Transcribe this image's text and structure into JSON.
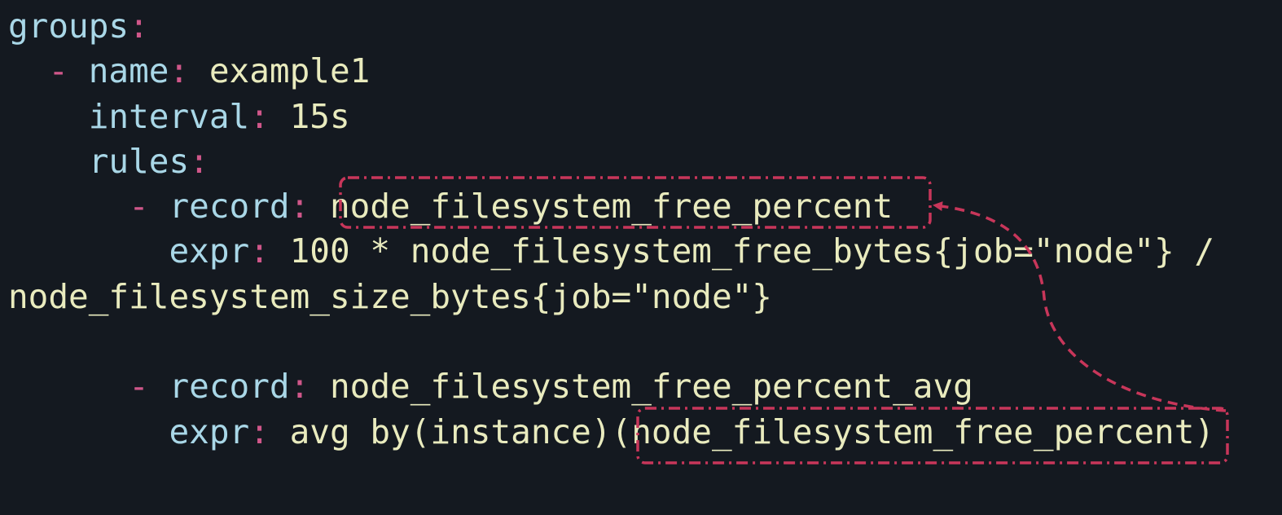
{
  "code": {
    "l1": {
      "key": "groups",
      "colon": ":"
    },
    "l2": {
      "dash": "-",
      "key": "name",
      "colon": ":",
      "value": "example1"
    },
    "l3": {
      "key": "interval",
      "colon": ":",
      "value": "15s"
    },
    "l4": {
      "key": "rules",
      "colon": ":"
    },
    "l5": {
      "dash": "-",
      "key": "record",
      "colon": ":",
      "value": "node_filesystem_free_percent"
    },
    "l6": {
      "key": "expr",
      "colon": ":",
      "value": "100 * node_filesystem_free_bytes{job=\"node\"} /"
    },
    "l7": {
      "value": "node_filesystem_size_bytes{job=\"node\"}"
    },
    "l9": {
      "dash": "-",
      "key": "record",
      "colon": ":",
      "value": "node_filesystem_free_percent_avg"
    },
    "l10": {
      "key": "expr",
      "colon": ":",
      "value_prefix": "avg by(instance)(",
      "value_ref": "node_filesystem_free_percent",
      "value_suffix": ")"
    }
  },
  "colors": {
    "background": "#141920",
    "key": "#a9d7e7",
    "punctuation": "#d0578a",
    "value": "#e9ebbe",
    "annotation": "#c8365a"
  }
}
